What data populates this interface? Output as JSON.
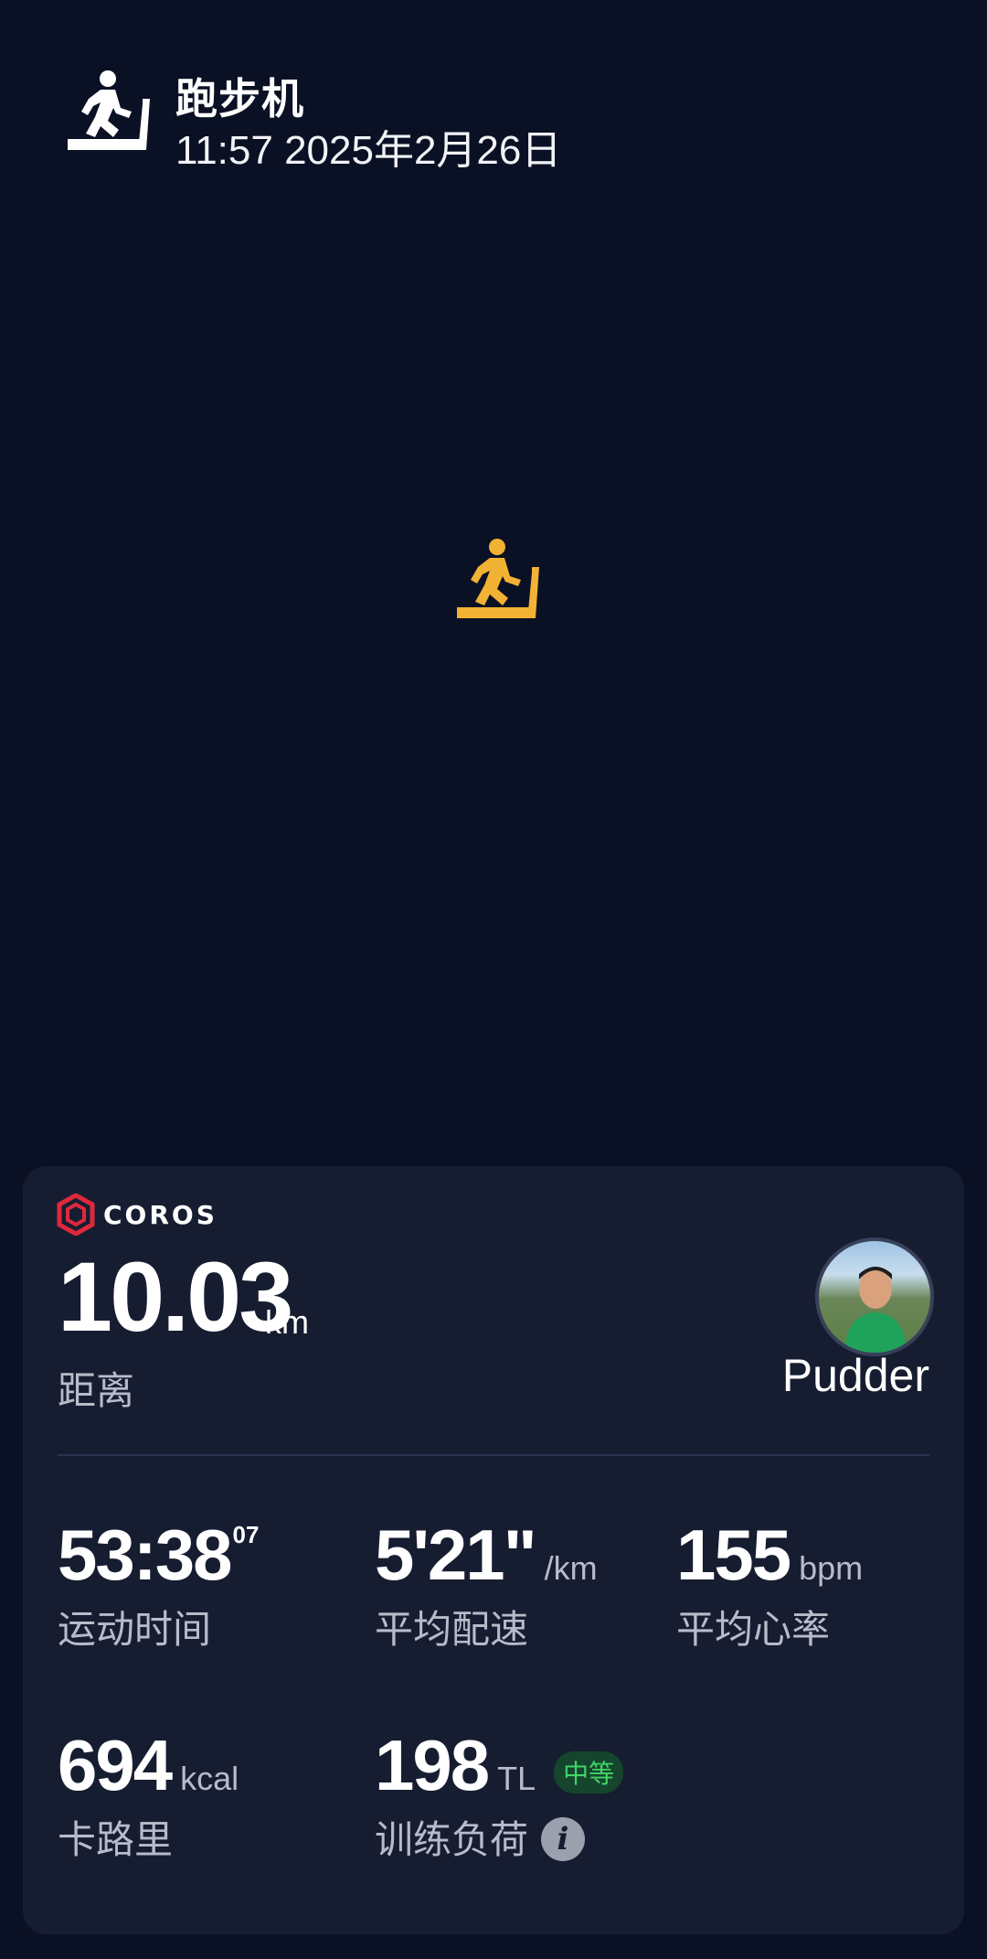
{
  "header": {
    "title": "跑步机",
    "datetime": "11:57 2025年2月26日",
    "icon": "treadmill-icon"
  },
  "colors": {
    "background": "#0b1124",
    "card": "#171d31",
    "ray_light": "#f2b233",
    "ray_dark": "#b94b15",
    "brand_red": "#e0283c",
    "badge_green": "#3fd466"
  },
  "card": {
    "brand": "COROS",
    "distance": {
      "value": "10.03",
      "unit": "km",
      "label": "距离"
    },
    "user": {
      "name": "Pudder"
    },
    "stats": {
      "time": {
        "value": "53:38",
        "sup": "07",
        "label": "运动时间"
      },
      "pace": {
        "value": "5'21\"",
        "unit": "/km",
        "label": "平均配速"
      },
      "heart_rate": {
        "value": "155",
        "unit": "bpm",
        "label": "平均心率"
      },
      "calories": {
        "value": "694",
        "unit": "kcal",
        "label": "卡路里"
      },
      "training_load": {
        "value": "198",
        "unit": "TL",
        "badge": "中等",
        "label": "训练负荷",
        "info_glyph": "i"
      }
    }
  }
}
